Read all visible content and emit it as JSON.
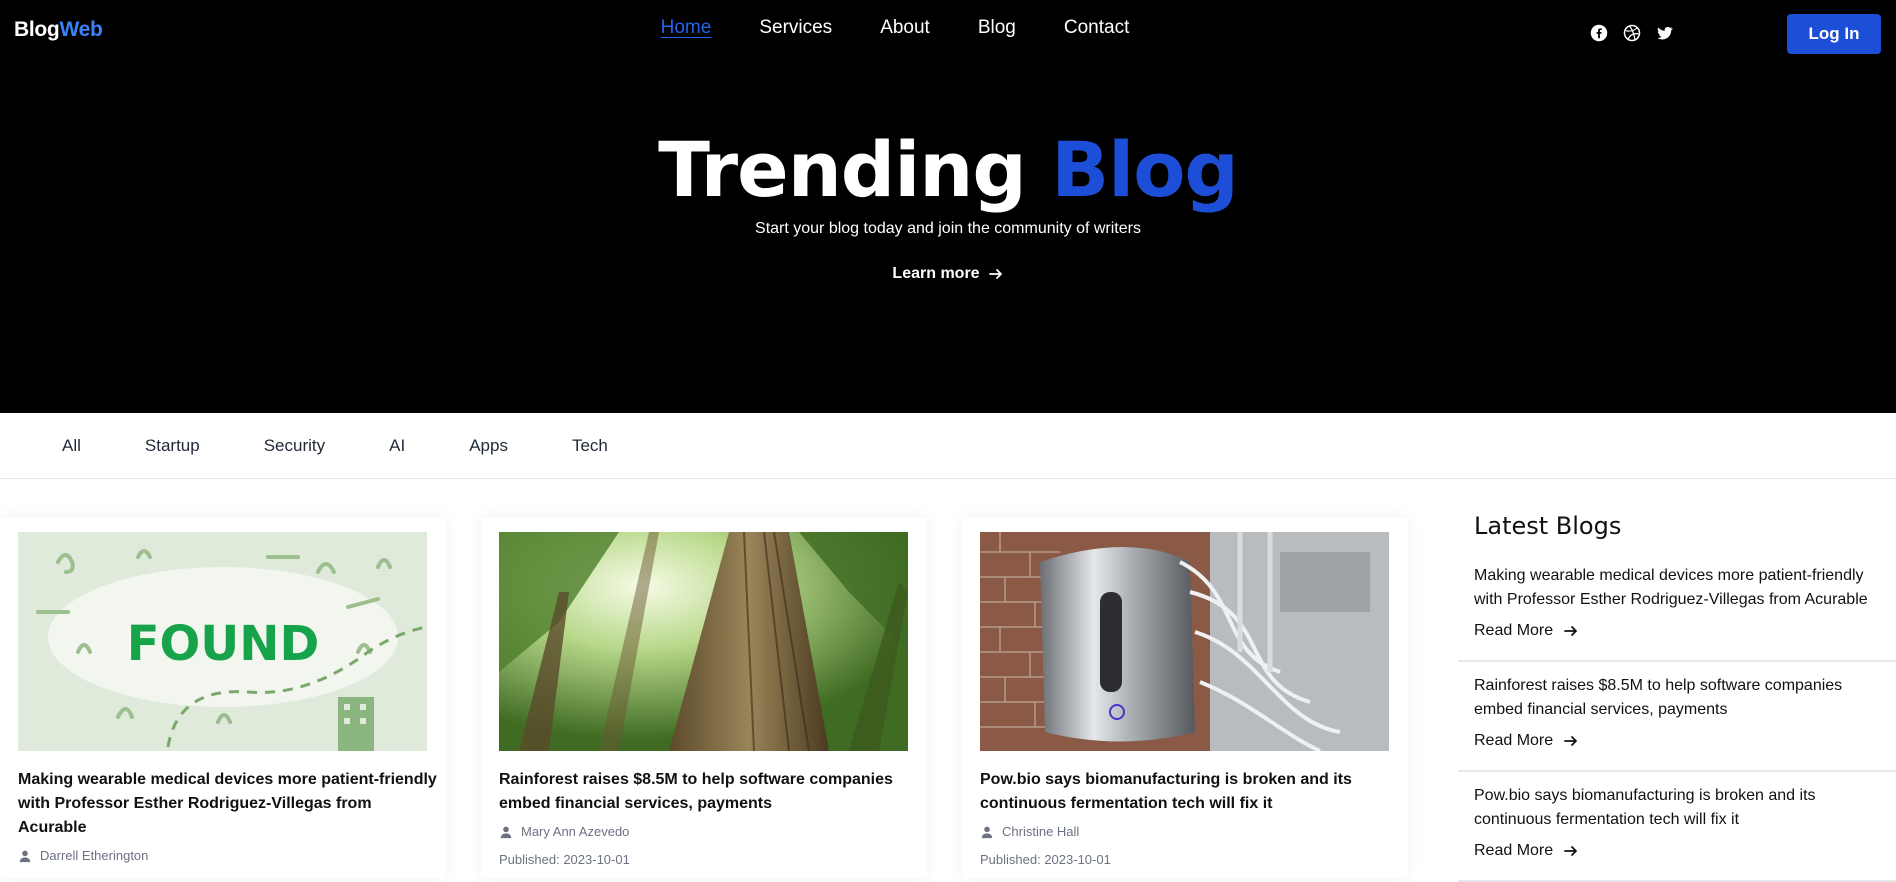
{
  "brand": {
    "part1": "Blog",
    "part2": "Web"
  },
  "nav": {
    "items": [
      "Home",
      "Services",
      "About",
      "Blog",
      "Contact"
    ],
    "active": "Home"
  },
  "social": [
    "facebook-icon",
    "dribbble-icon",
    "twitter-icon"
  ],
  "login_label": "Log In",
  "hero": {
    "title_part1": "Trending",
    "title_part2": "Blog",
    "subtitle": "Start your blog today and join the community of writers",
    "cta": "Learn more"
  },
  "categories": [
    "All",
    "Startup",
    "Security",
    "AI",
    "Apps",
    "Tech"
  ],
  "cards": [
    {
      "title": "Making wearable medical devices more patient-friendly with Professor Esther Rodriguez-Villegas from Acurable",
      "author": "Darrell Etherington",
      "image_text": "FOUND"
    },
    {
      "title": "Rainforest raises $8.5M to help software companies embed financial services, payments",
      "author": "Mary Ann Azevedo",
      "published": "Published: 2023-10-01"
    },
    {
      "title": "Pow.bio says biomanufacturing is broken and its continuous fermentation tech will fix it",
      "author": "Christine Hall",
      "published": "Published: 2023-10-01"
    }
  ],
  "latest": {
    "heading": "Latest Blogs",
    "items": [
      {
        "title": "Making wearable medical devices more patient-friendly with Professor Esther Rodriguez-Villegas from Acurable",
        "read_more": "Read More"
      },
      {
        "title": "Rainforest raises $8.5M to help software companies embed financial services, payments",
        "read_more": "Read More"
      },
      {
        "title": "Pow.bio says biomanufacturing is broken and its continuous fermentation tech will fix it",
        "read_more": "Read More"
      }
    ]
  },
  "colors": {
    "accent": "#1d4ed8",
    "brand_accent": "#3b82f6",
    "hero_bg": "#000000"
  }
}
